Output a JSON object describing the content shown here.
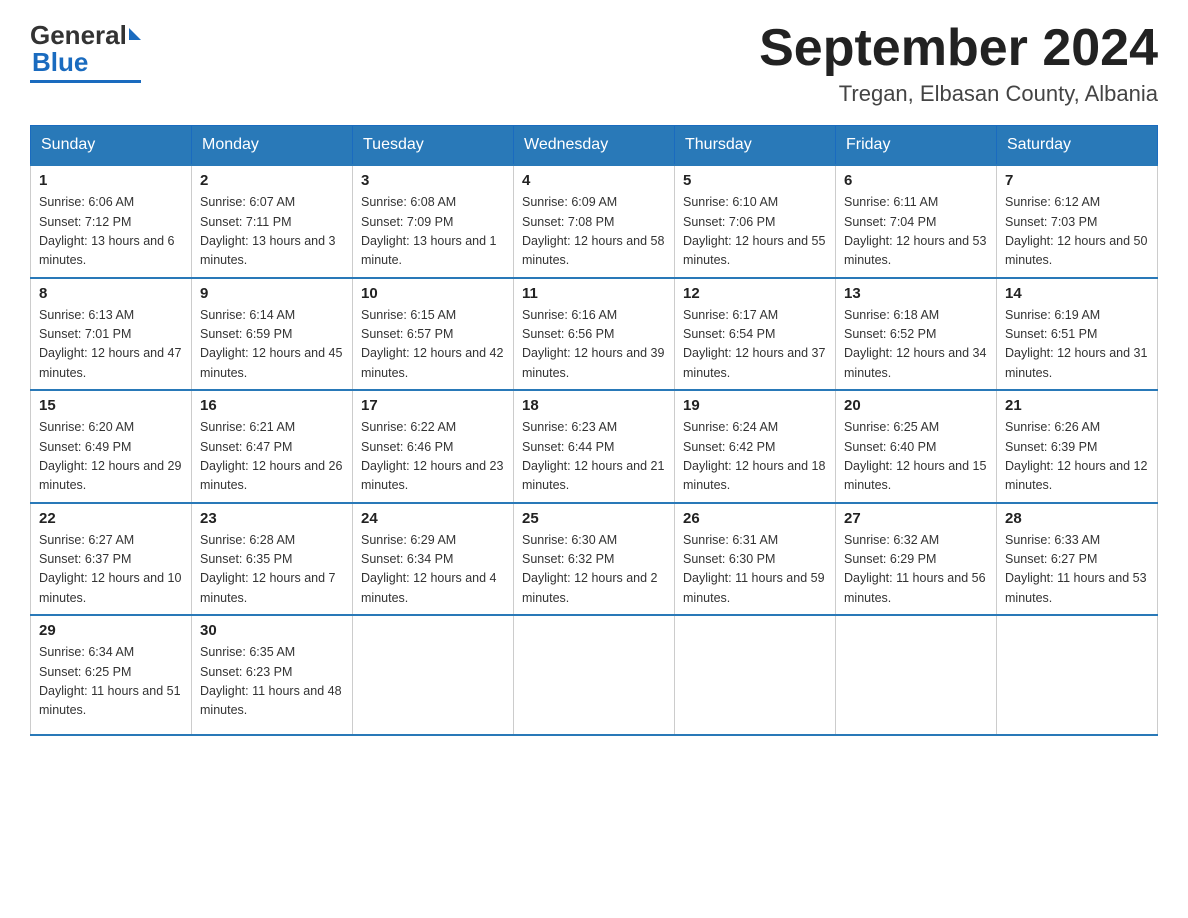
{
  "header": {
    "logo_general": "General",
    "logo_blue": "Blue",
    "month_title": "September 2024",
    "location": "Tregan, Elbasan County, Albania"
  },
  "weekdays": [
    "Sunday",
    "Monday",
    "Tuesday",
    "Wednesday",
    "Thursday",
    "Friday",
    "Saturday"
  ],
  "weeks": [
    [
      {
        "day": "1",
        "sunrise": "Sunrise: 6:06 AM",
        "sunset": "Sunset: 7:12 PM",
        "daylight": "Daylight: 13 hours and 6 minutes."
      },
      {
        "day": "2",
        "sunrise": "Sunrise: 6:07 AM",
        "sunset": "Sunset: 7:11 PM",
        "daylight": "Daylight: 13 hours and 3 minutes."
      },
      {
        "day": "3",
        "sunrise": "Sunrise: 6:08 AM",
        "sunset": "Sunset: 7:09 PM",
        "daylight": "Daylight: 13 hours and 1 minute."
      },
      {
        "day": "4",
        "sunrise": "Sunrise: 6:09 AM",
        "sunset": "Sunset: 7:08 PM",
        "daylight": "Daylight: 12 hours and 58 minutes."
      },
      {
        "day": "5",
        "sunrise": "Sunrise: 6:10 AM",
        "sunset": "Sunset: 7:06 PM",
        "daylight": "Daylight: 12 hours and 55 minutes."
      },
      {
        "day": "6",
        "sunrise": "Sunrise: 6:11 AM",
        "sunset": "Sunset: 7:04 PM",
        "daylight": "Daylight: 12 hours and 53 minutes."
      },
      {
        "day": "7",
        "sunrise": "Sunrise: 6:12 AM",
        "sunset": "Sunset: 7:03 PM",
        "daylight": "Daylight: 12 hours and 50 minutes."
      }
    ],
    [
      {
        "day": "8",
        "sunrise": "Sunrise: 6:13 AM",
        "sunset": "Sunset: 7:01 PM",
        "daylight": "Daylight: 12 hours and 47 minutes."
      },
      {
        "day": "9",
        "sunrise": "Sunrise: 6:14 AM",
        "sunset": "Sunset: 6:59 PM",
        "daylight": "Daylight: 12 hours and 45 minutes."
      },
      {
        "day": "10",
        "sunrise": "Sunrise: 6:15 AM",
        "sunset": "Sunset: 6:57 PM",
        "daylight": "Daylight: 12 hours and 42 minutes."
      },
      {
        "day": "11",
        "sunrise": "Sunrise: 6:16 AM",
        "sunset": "Sunset: 6:56 PM",
        "daylight": "Daylight: 12 hours and 39 minutes."
      },
      {
        "day": "12",
        "sunrise": "Sunrise: 6:17 AM",
        "sunset": "Sunset: 6:54 PM",
        "daylight": "Daylight: 12 hours and 37 minutes."
      },
      {
        "day": "13",
        "sunrise": "Sunrise: 6:18 AM",
        "sunset": "Sunset: 6:52 PM",
        "daylight": "Daylight: 12 hours and 34 minutes."
      },
      {
        "day": "14",
        "sunrise": "Sunrise: 6:19 AM",
        "sunset": "Sunset: 6:51 PM",
        "daylight": "Daylight: 12 hours and 31 minutes."
      }
    ],
    [
      {
        "day": "15",
        "sunrise": "Sunrise: 6:20 AM",
        "sunset": "Sunset: 6:49 PM",
        "daylight": "Daylight: 12 hours and 29 minutes."
      },
      {
        "day": "16",
        "sunrise": "Sunrise: 6:21 AM",
        "sunset": "Sunset: 6:47 PM",
        "daylight": "Daylight: 12 hours and 26 minutes."
      },
      {
        "day": "17",
        "sunrise": "Sunrise: 6:22 AM",
        "sunset": "Sunset: 6:46 PM",
        "daylight": "Daylight: 12 hours and 23 minutes."
      },
      {
        "day": "18",
        "sunrise": "Sunrise: 6:23 AM",
        "sunset": "Sunset: 6:44 PM",
        "daylight": "Daylight: 12 hours and 21 minutes."
      },
      {
        "day": "19",
        "sunrise": "Sunrise: 6:24 AM",
        "sunset": "Sunset: 6:42 PM",
        "daylight": "Daylight: 12 hours and 18 minutes."
      },
      {
        "day": "20",
        "sunrise": "Sunrise: 6:25 AM",
        "sunset": "Sunset: 6:40 PM",
        "daylight": "Daylight: 12 hours and 15 minutes."
      },
      {
        "day": "21",
        "sunrise": "Sunrise: 6:26 AM",
        "sunset": "Sunset: 6:39 PM",
        "daylight": "Daylight: 12 hours and 12 minutes."
      }
    ],
    [
      {
        "day": "22",
        "sunrise": "Sunrise: 6:27 AM",
        "sunset": "Sunset: 6:37 PM",
        "daylight": "Daylight: 12 hours and 10 minutes."
      },
      {
        "day": "23",
        "sunrise": "Sunrise: 6:28 AM",
        "sunset": "Sunset: 6:35 PM",
        "daylight": "Daylight: 12 hours and 7 minutes."
      },
      {
        "day": "24",
        "sunrise": "Sunrise: 6:29 AM",
        "sunset": "Sunset: 6:34 PM",
        "daylight": "Daylight: 12 hours and 4 minutes."
      },
      {
        "day": "25",
        "sunrise": "Sunrise: 6:30 AM",
        "sunset": "Sunset: 6:32 PM",
        "daylight": "Daylight: 12 hours and 2 minutes."
      },
      {
        "day": "26",
        "sunrise": "Sunrise: 6:31 AM",
        "sunset": "Sunset: 6:30 PM",
        "daylight": "Daylight: 11 hours and 59 minutes."
      },
      {
        "day": "27",
        "sunrise": "Sunrise: 6:32 AM",
        "sunset": "Sunset: 6:29 PM",
        "daylight": "Daylight: 11 hours and 56 minutes."
      },
      {
        "day": "28",
        "sunrise": "Sunrise: 6:33 AM",
        "sunset": "Sunset: 6:27 PM",
        "daylight": "Daylight: 11 hours and 53 minutes."
      }
    ],
    [
      {
        "day": "29",
        "sunrise": "Sunrise: 6:34 AM",
        "sunset": "Sunset: 6:25 PM",
        "daylight": "Daylight: 11 hours and 51 minutes."
      },
      {
        "day": "30",
        "sunrise": "Sunrise: 6:35 AM",
        "sunset": "Sunset: 6:23 PM",
        "daylight": "Daylight: 11 hours and 48 minutes."
      },
      null,
      null,
      null,
      null,
      null
    ]
  ]
}
